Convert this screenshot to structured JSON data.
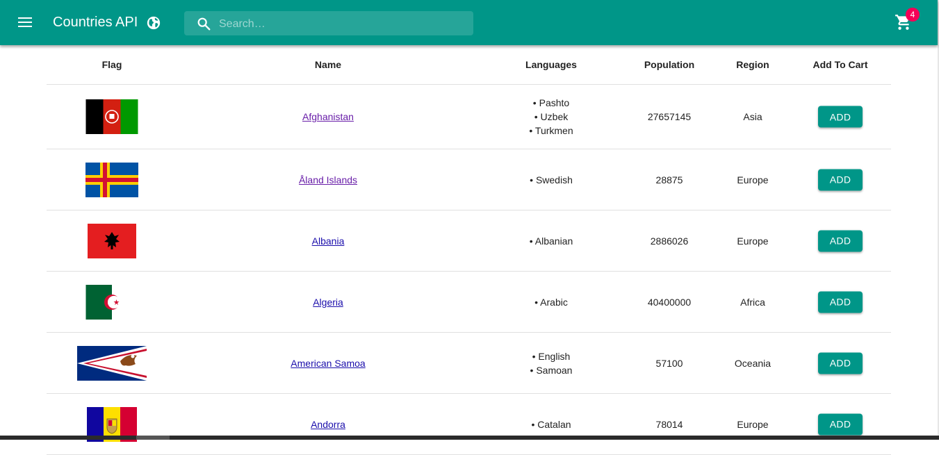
{
  "header": {
    "title": "Countries API",
    "search_placeholder": "Search…",
    "cart_count": "4",
    "colors": {
      "primary": "#009688",
      "badge": "#f50057"
    }
  },
  "table": {
    "columns": [
      "Flag",
      "Name",
      "Languages",
      "Population",
      "Region",
      "Add To Cart"
    ],
    "rows": [
      {
        "name": "Afghanistan",
        "languages": [
          "Pashto",
          "Uzbek",
          "Turkmen"
        ],
        "population": "27657145",
        "region": "Asia",
        "button": "ADD",
        "flag_icon": "afghanistan-flag-icon"
      },
      {
        "name": "Åland Islands",
        "languages": [
          "Swedish"
        ],
        "population": "28875",
        "region": "Europe",
        "button": "ADD",
        "flag_icon": "aland-islands-flag-icon"
      },
      {
        "name": "Albania",
        "languages": [
          "Albanian"
        ],
        "population": "2886026",
        "region": "Europe",
        "button": "ADD",
        "flag_icon": "albania-flag-icon"
      },
      {
        "name": "Algeria",
        "languages": [
          "Arabic"
        ],
        "population": "40400000",
        "region": "Africa",
        "button": "ADD",
        "flag_icon": "algeria-flag-icon"
      },
      {
        "name": "American Samoa",
        "languages": [
          "English",
          "Samoan"
        ],
        "population": "57100",
        "region": "Oceania",
        "button": "ADD",
        "flag_icon": "american-samoa-flag-icon"
      },
      {
        "name": "Andorra",
        "languages": [
          "Catalan"
        ],
        "population": "78014",
        "region": "Europe",
        "button": "ADD",
        "flag_icon": "andorra-flag-icon"
      }
    ]
  }
}
